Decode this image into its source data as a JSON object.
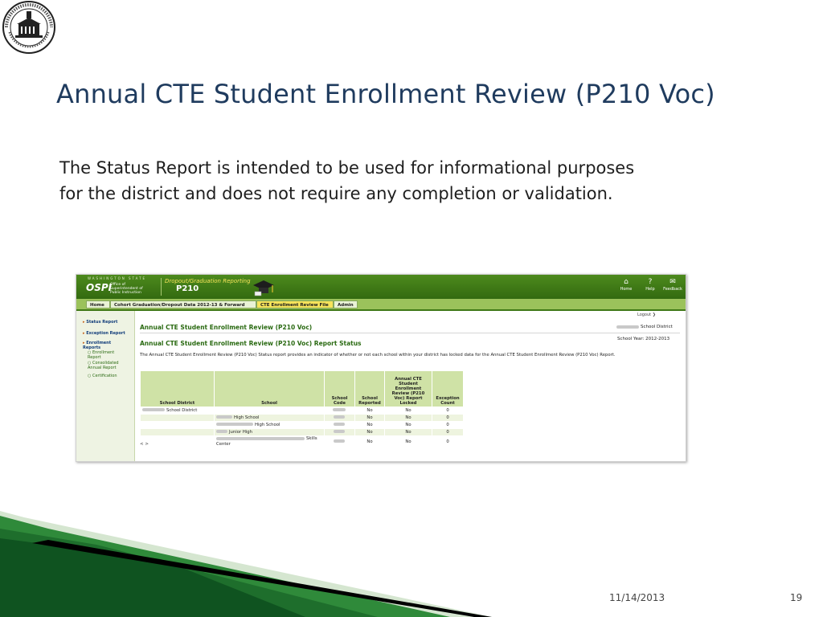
{
  "slide": {
    "title": "Annual CTE Student Enrollment Review (P210 Voc)",
    "body_line1": "The Status Report is intended to be used for informational purposes",
    "body_line2": "for the district and does not require any completion or validation.",
    "footer_date": "11/14/2013",
    "page_number": "19",
    "seal_icon": "ospi-seal-icon"
  },
  "screenshot": {
    "banner": {
      "state_text": "WASHINGTON STATE",
      "logo_text": "OSPI",
      "office_text": "Office of Superintendent of Public Instruction",
      "app_subtitle": "Dropout/Graduation Reporting",
      "app_title": "P210",
      "links": [
        {
          "label": "Home",
          "glyph": "⌂"
        },
        {
          "label": "Help",
          "glyph": "?"
        },
        {
          "label": "Feedback",
          "glyph": "✉"
        }
      ]
    },
    "tabs": [
      {
        "label": "Home"
      },
      {
        "label": "Cohort Graduation/Dropout Data 2012-13 & Forward"
      },
      {
        "label": "CTE Enrollment Review File"
      },
      {
        "label": "Admin"
      }
    ],
    "sidebar": {
      "status_report": "Status Report",
      "exception_report": "Exception Report",
      "enrollment_reports": "Enrollment Reports",
      "enrollment_report": "Enrollment Report",
      "consolidated_report": "Consolidated Annual Report",
      "certification": "Certification"
    },
    "logout": "Logout",
    "main_heading": "Annual CTE Student Enrollment Review (P210 Voc)",
    "district_label": "School District",
    "status_heading": "Annual CTE Student Enrollment Review (P210 Voc) Report Status",
    "school_year": "School Year: 2012-2013",
    "description": "The Annual CTE Student Enrollment Review (P210 Voc) Status report provides an indicator of whether or not each school within your district has locked data for the Annual CTE Student Enrollment Review (P210 Voc) Report.",
    "table": {
      "headers": [
        "School District",
        "School",
        "School Code",
        "School Reported",
        "Annual CTE Student Enrollment Review (P210 Voc) Report Locked",
        "Exception Count"
      ],
      "rows": [
        {
          "district": "School District",
          "school": "",
          "reported": "No",
          "locked": "No",
          "exceptions": "0"
        },
        {
          "district": "",
          "school": "High School",
          "reported": "No",
          "locked": "No",
          "exceptions": "0"
        },
        {
          "district": "",
          "school": "High School",
          "reported": "No",
          "locked": "No",
          "exceptions": "0"
        },
        {
          "district": "",
          "school": "Junior High",
          "reported": "No",
          "locked": "No",
          "exceptions": "0"
        },
        {
          "district": "",
          "school": "Skills Center",
          "reported": "No",
          "locked": "No",
          "exceptions": "0"
        }
      ]
    },
    "pager": "< >"
  }
}
